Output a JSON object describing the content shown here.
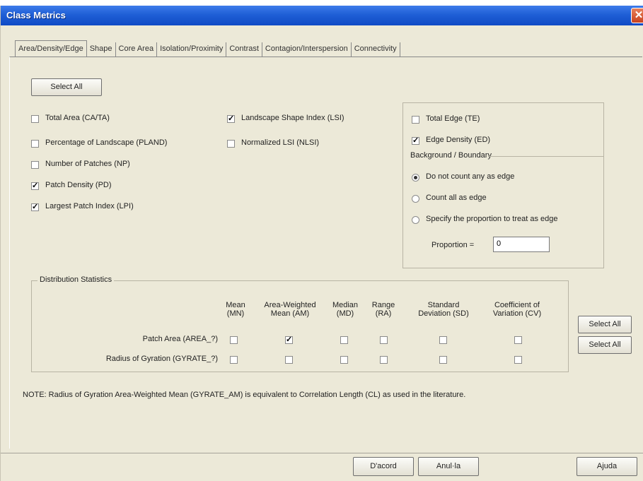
{
  "window": {
    "title": "Class Metrics",
    "close_glyph": "✕"
  },
  "tabs": [
    "Area/Density/Edge",
    "Shape",
    "Core Area",
    "Isolation/Proximity",
    "Contrast",
    "Contagion/Interspersion",
    "Connectivity"
  ],
  "select_all_top": "Select All",
  "area_metrics": [
    {
      "label": "Total Area (CA/TA)",
      "checked": false
    },
    {
      "label": "Percentage of Landscape (PLAND)",
      "checked": false
    },
    {
      "label": "Number of Patches (NP)",
      "checked": false
    },
    {
      "label": "Patch Density (PD)",
      "checked": true
    },
    {
      "label": "Largest Patch Index (LPI)",
      "checked": true
    }
  ],
  "shape_metrics": [
    {
      "label": "Landscape Shape Index (LSI)",
      "checked": true
    },
    {
      "label": "Normalized LSI (NLSI)",
      "checked": false
    }
  ],
  "edge_metrics": [
    {
      "label": "Total Edge (TE)",
      "checked": false
    },
    {
      "label": "Edge Density (ED)",
      "checked": true
    }
  ],
  "boundary": {
    "title": "Background / Boundary",
    "options": [
      {
        "label": "Do not count any as edge",
        "selected": true
      },
      {
        "label": "Count all as edge",
        "selected": false
      },
      {
        "label": "Specify the proportion to treat as edge",
        "selected": false
      }
    ],
    "proportion_label": "Proportion =",
    "proportion_value": "0"
  },
  "distribution": {
    "title": "Distribution Statistics",
    "columns": [
      {
        "line1": "Mean",
        "line2": "(MN)"
      },
      {
        "line1": "Area-Weighted",
        "line2": "Mean (AM)"
      },
      {
        "line1": "Median",
        "line2": "(MD)"
      },
      {
        "line1": "Range",
        "line2": "(RA)"
      },
      {
        "line1": "Standard",
        "line2": "Deviation (SD)"
      },
      {
        "line1": "Coefficient of",
        "line2": "Variation (CV)"
      }
    ],
    "rows": [
      {
        "label": "Patch Area (AREA_?)",
        "checks": [
          false,
          true,
          false,
          false,
          false,
          false
        ],
        "button": "Select All"
      },
      {
        "label": "Radius of Gyration (GYRATE_?)",
        "checks": [
          false,
          false,
          false,
          false,
          false,
          false
        ],
        "button": "Select All"
      }
    ]
  },
  "note": "NOTE: Radius of Gyration Area-Weighted Mean (GYRATE_AM) is equivalent to Correlation Length (CL) as used in the literature.",
  "footer": {
    "ok": "D'acord",
    "cancel": "Anul·la",
    "help": "Ajuda"
  },
  "colors": {
    "title_bar": "#1f5fd6",
    "dialog_bg": "#ece9d8",
    "close": "#c8421f"
  }
}
